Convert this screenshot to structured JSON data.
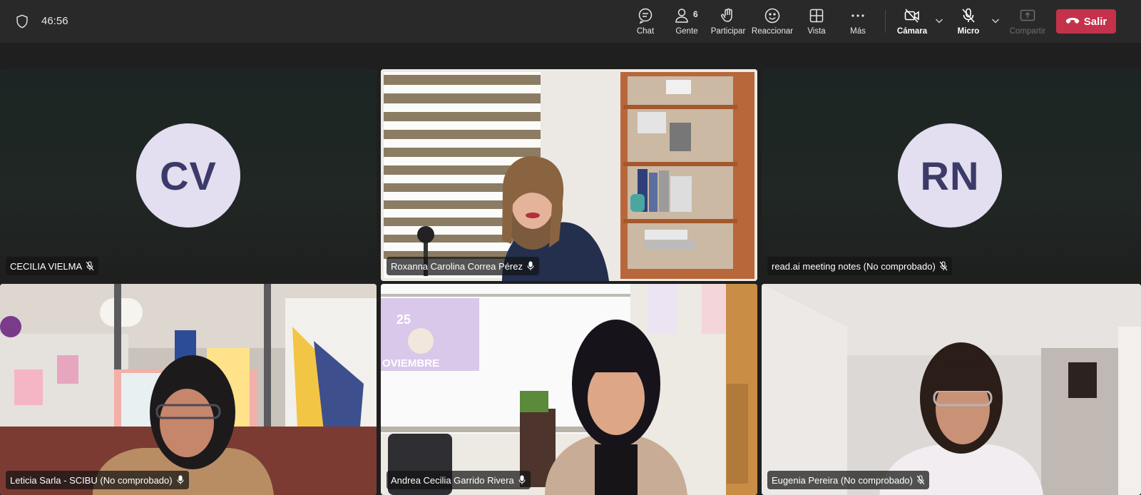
{
  "meeting": {
    "timer": "46:56"
  },
  "toolbar": {
    "chat": "Chat",
    "people": "Gente",
    "people_count": "6",
    "raise": "Participar",
    "react": "Reaccionar",
    "view": "Vista",
    "more": "Más",
    "camera": "Cámara",
    "mic": "Micro",
    "share": "Compartir",
    "leave": "Salir"
  },
  "participants": [
    {
      "name": "CECILIA VIELMA",
      "initials": "CV",
      "mic": "muted",
      "video": false
    },
    {
      "name": "Roxanna Carolina Correa Pérez",
      "mic": "on",
      "video": true,
      "speaking": true
    },
    {
      "name": "read.ai meeting notes (No comprobado)",
      "initials": "RN",
      "mic": "muted",
      "video": false
    },
    {
      "name": "Leticia Sarla - SCIBU (No comprobado)",
      "mic": "on",
      "video": true
    },
    {
      "name": "Andrea Cecilia Garrido Rivera",
      "mic": "on",
      "video": true
    },
    {
      "name": "Eugenia Pereira (No comprobado)",
      "mic": "muted",
      "video": true
    }
  ],
  "scene_text": {
    "poster_number": "25",
    "poster_word": "OVIEMBRE"
  },
  "colors": {
    "leave_button": "#c4314b",
    "active_speaker_border": "#7f85f5",
    "avatar_bg": "#e3def0",
    "avatar_text": "#3b3a68"
  }
}
